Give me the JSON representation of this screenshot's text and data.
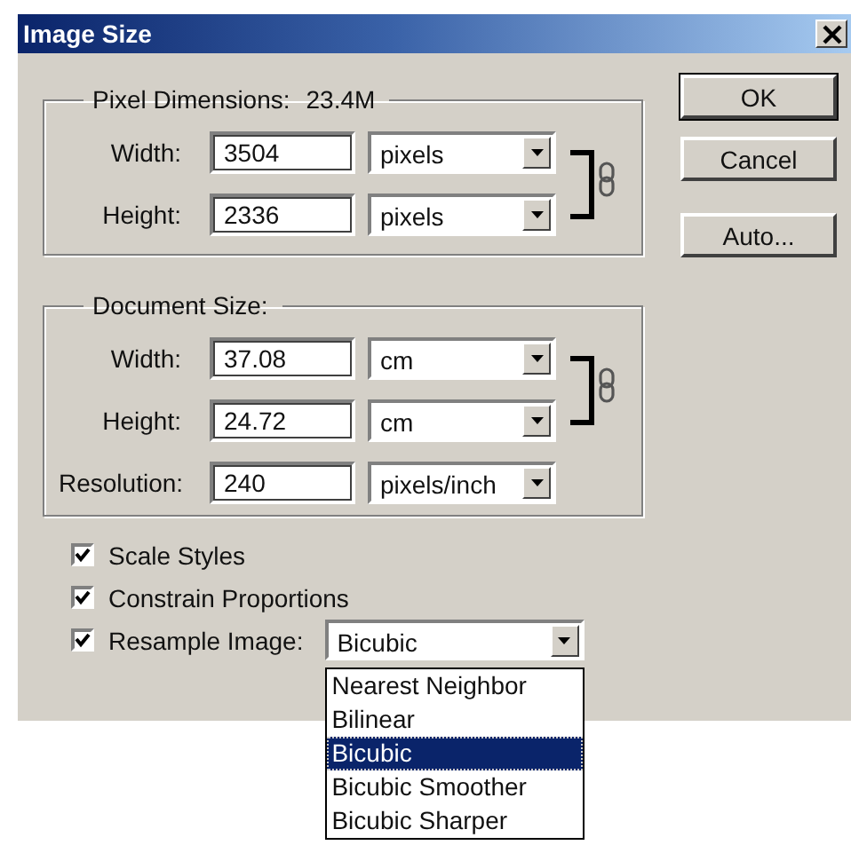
{
  "window": {
    "title": "Image Size"
  },
  "pixel_dimensions": {
    "legend": "Pixel Dimensions:",
    "value": "23.4M",
    "rows": [
      {
        "label": "Width:",
        "value": "3504",
        "unit": "pixels"
      },
      {
        "label": "Height:",
        "value": "2336",
        "unit": "pixels"
      }
    ]
  },
  "document_size": {
    "legend": "Document Size:",
    "rows": [
      {
        "label": "Width:",
        "value": "37.08",
        "unit": "cm"
      },
      {
        "label": "Height:",
        "value": "24.72",
        "unit": "cm"
      },
      {
        "label": "Resolution:",
        "value": "240",
        "unit": "pixels/inch"
      }
    ]
  },
  "checkboxes": [
    {
      "label": "Scale Styles",
      "checked": true
    },
    {
      "label": "Constrain Proportions",
      "checked": true
    }
  ],
  "resample": {
    "label": "Resample Image:",
    "checked": true,
    "value": "Bicubic",
    "options": [
      {
        "label": "Nearest Neighbor",
        "selected": false
      },
      {
        "label": "Bilinear",
        "selected": false
      },
      {
        "label": "Bicubic",
        "selected": true
      },
      {
        "label": "Bicubic Smoother",
        "selected": false
      },
      {
        "label": "Bicubic Sharper",
        "selected": false
      }
    ]
  },
  "buttons": [
    {
      "label": "OK",
      "default": true
    },
    {
      "label": "Cancel",
      "default": false
    },
    {
      "label": "Auto...",
      "default": false
    }
  ]
}
